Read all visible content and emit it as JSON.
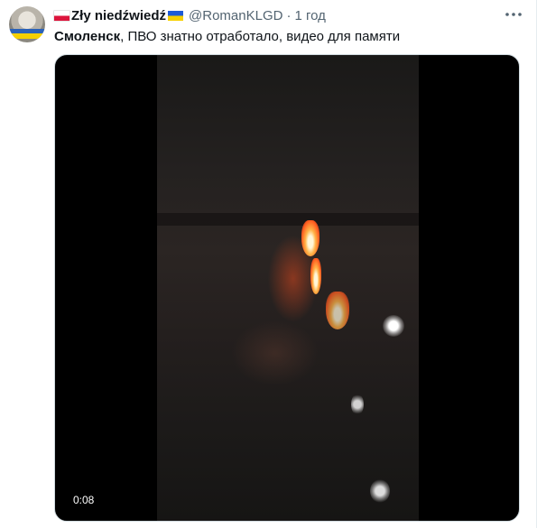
{
  "tweet": {
    "author_name": "Zły niedźwiedź",
    "author_flag_left": "poland-flag-icon",
    "author_flag_right": "ukraine-flag-icon",
    "handle": "@RomanKLGD",
    "separator": "·",
    "time": "1 год",
    "text_bold": "Смоленск",
    "text_rest": ", ПВО знатно отработало, видео для памяти",
    "more_icon": "more-options-icon"
  },
  "media": {
    "type": "video",
    "duration": "0:08"
  },
  "colors": {
    "text": "#0f1419",
    "secondary": "#536471",
    "media_bg": "#000000",
    "fire": "#ff5a1f"
  }
}
